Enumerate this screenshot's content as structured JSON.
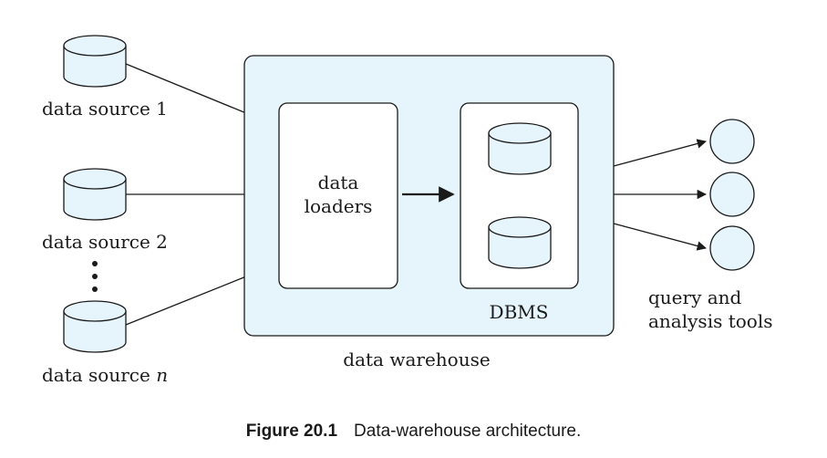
{
  "sources": [
    {
      "label": "data source 1",
      "suffix": ""
    },
    {
      "label": "data source 2",
      "suffix": ""
    },
    {
      "label": "data source ",
      "suffix": "n"
    }
  ],
  "warehouse": {
    "label": "data warehouse",
    "loaders_line1": "data",
    "loaders_line2": "loaders",
    "dbms_label": "DBMS"
  },
  "tools": {
    "line1": "query and",
    "line2": "analysis tools"
  },
  "caption": {
    "label": "Figure 20.1",
    "text": "Data-warehouse architecture."
  },
  "colors": {
    "fill": "#e6f4fb",
    "stroke": "#1a1a1a"
  }
}
